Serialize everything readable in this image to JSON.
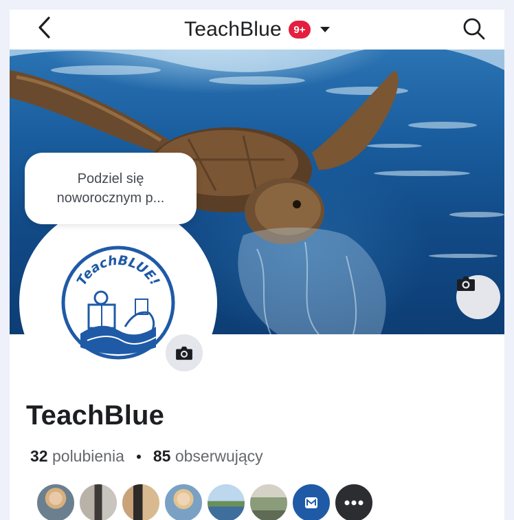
{
  "header": {
    "title": "TeachBlue",
    "badge": "9+",
    "icons": [
      "back-arrow-icon",
      "chevron-down-icon",
      "search-icon"
    ]
  },
  "cover": {
    "camera_icon": "camera-icon"
  },
  "avatar": {
    "logo_text": "TeachBLUE!",
    "camera_icon": "camera-icon"
  },
  "bubble": {
    "line1": "Podziel się",
    "line2": "noworocznym p..."
  },
  "profile": {
    "name": "TeachBlue",
    "likes_count": "32",
    "likes_label": "polubienia",
    "followers_count": "85",
    "followers_label": "obserwujący"
  },
  "followers": [
    {
      "name": "follower-1"
    },
    {
      "name": "follower-2"
    },
    {
      "name": "follower-3"
    },
    {
      "name": "follower-4"
    },
    {
      "name": "follower-5"
    },
    {
      "name": "follower-6"
    },
    {
      "name": "follower-7"
    },
    {
      "name": "follower-8"
    }
  ],
  "colors": {
    "badge": "#e41e3f",
    "accent": "#1f5aa6",
    "frame": "#eef1f9"
  }
}
